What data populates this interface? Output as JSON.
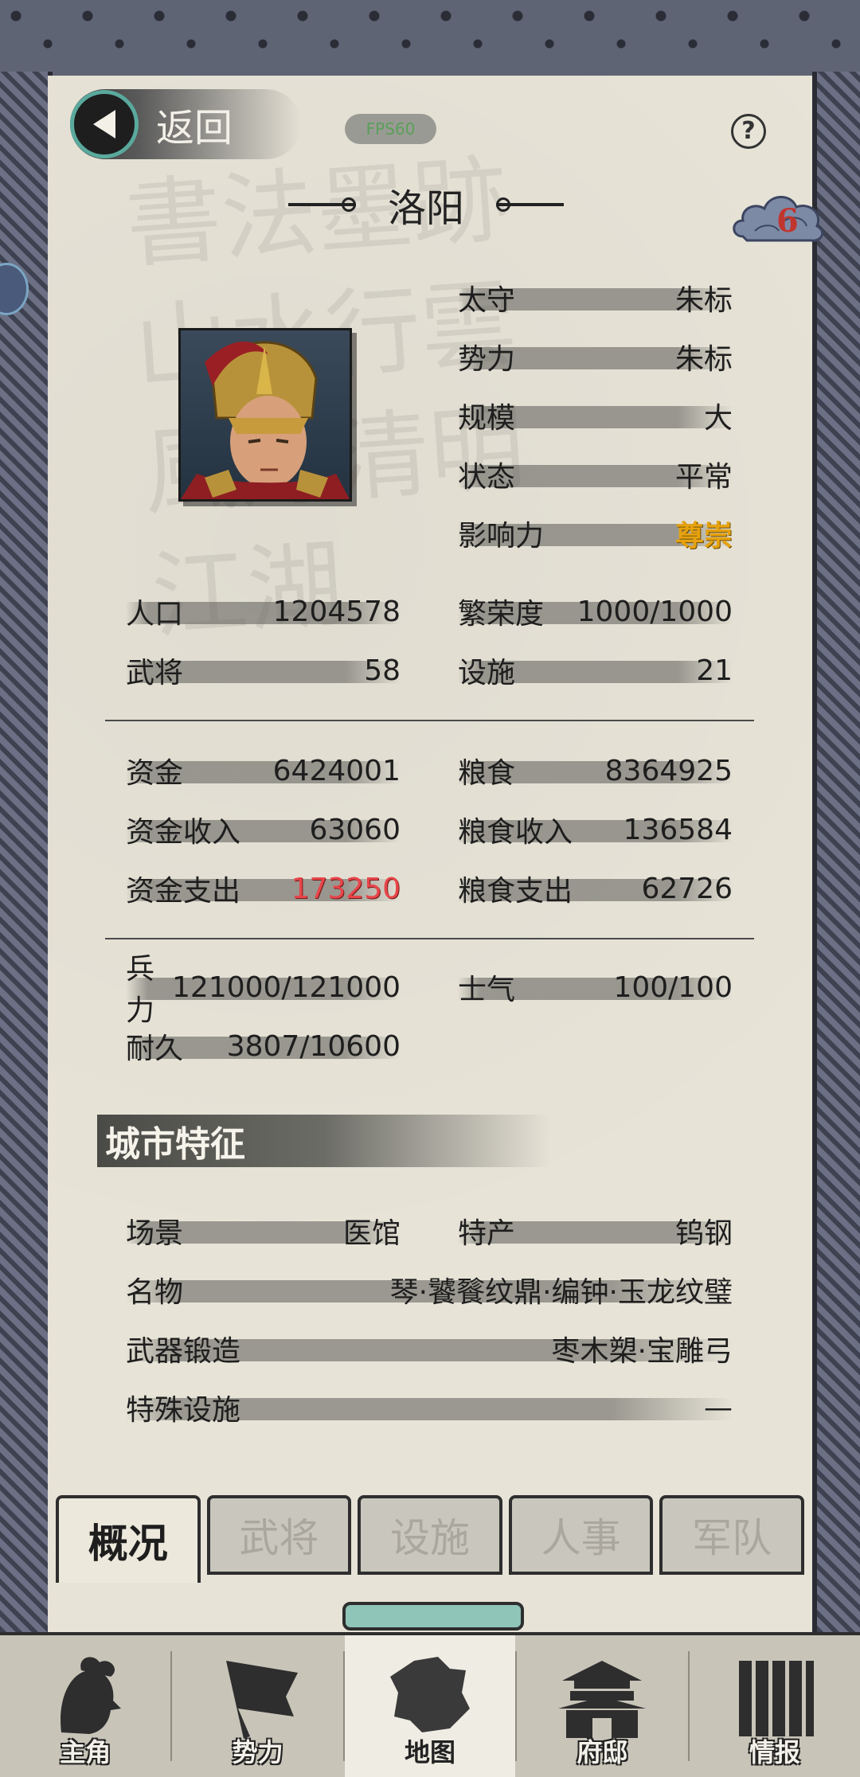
{
  "header": {
    "back_label": "返回",
    "fps_label": "FPS60",
    "help_symbol": "?",
    "city_name": "洛阳",
    "badge_count": "6"
  },
  "governor": {
    "rows": [
      {
        "label": "太守",
        "value": "朱标"
      },
      {
        "label": "势力",
        "value": "朱标"
      },
      {
        "label": "规模",
        "value": "大"
      },
      {
        "label": "状态",
        "value": "平常"
      },
      {
        "label": "影响力",
        "value": "尊崇"
      }
    ]
  },
  "stats": {
    "population_label": "人口",
    "population_value": "1204578",
    "prosperity_label": "繁荣度",
    "prosperity_value": "1000/1000",
    "generals_label": "武将",
    "generals_value": "58",
    "facilities_label": "设施",
    "facilities_value": "21"
  },
  "economy": {
    "funds_label": "资金",
    "funds_value": "6424001",
    "food_label": "粮食",
    "food_value": "8364925",
    "funds_income_label": "资金收入",
    "funds_income_value": "63060",
    "food_income_label": "粮食收入",
    "food_income_value": "136584",
    "funds_expense_label": "资金支出",
    "funds_expense_value": "173250",
    "food_expense_label": "粮食支出",
    "food_expense_value": "62726"
  },
  "military": {
    "troops_label": "兵力",
    "troops_value": "121000/121000",
    "morale_label": "士气",
    "morale_value": "100/100",
    "durability_label": "耐久",
    "durability_value": "3807/10600"
  },
  "features": {
    "section_title": "城市特征",
    "scene_label": "场景",
    "scene_value": "医馆",
    "specialty_label": "特产",
    "specialty_value": "钨钢",
    "famous_label": "名物",
    "famous_value": "琴·饕餮纹鼎·编钟·玉龙纹璧",
    "forge_label": "武器锻造",
    "forge_value": "枣木槊·宝雕弓",
    "special_label": "特殊设施",
    "special_value": "—"
  },
  "tabs": [
    "概况",
    "武将",
    "设施",
    "人事",
    "军队"
  ],
  "nav": [
    "主角",
    "势力",
    "地图",
    "府邸",
    "情报"
  ],
  "colors": {
    "accent_teal": "#5aa99d",
    "influence_gold": "#e6a20f",
    "expense_red": "#e8464a"
  }
}
